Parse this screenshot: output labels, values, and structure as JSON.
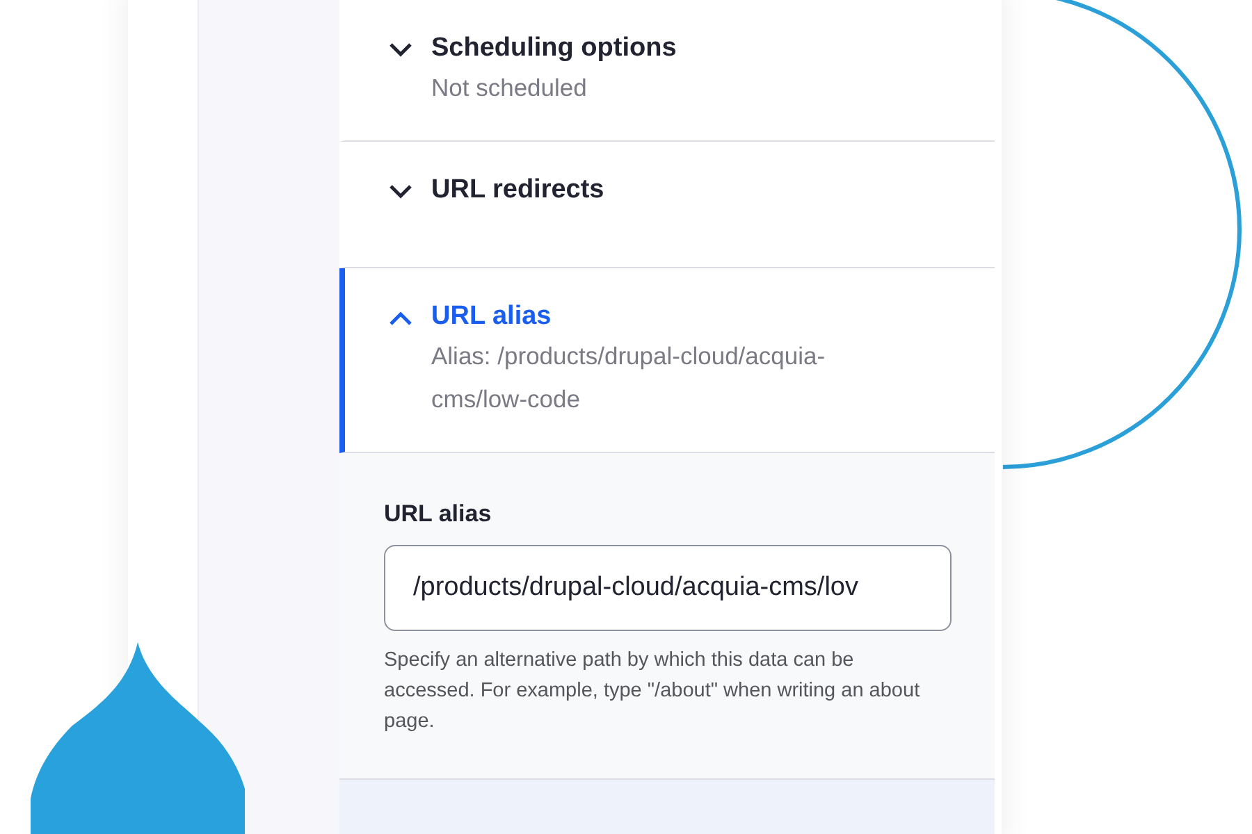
{
  "sections": [
    {
      "title": "Scheduling options",
      "summary": "Not scheduled",
      "expanded": false
    },
    {
      "title": "URL redirects",
      "expanded": false
    },
    {
      "title": "URL alias",
      "summary": "Alias: /products/drupal-cloud/acquia-cms/low-code",
      "expanded": true
    }
  ],
  "alias_field": {
    "label": "URL alias",
    "value": "/products/drupal-cloud/acquia-cms/lov",
    "description": "Specify an alternative path by which this data can be accessed. For example, type \"/about\" when writing an about page."
  }
}
